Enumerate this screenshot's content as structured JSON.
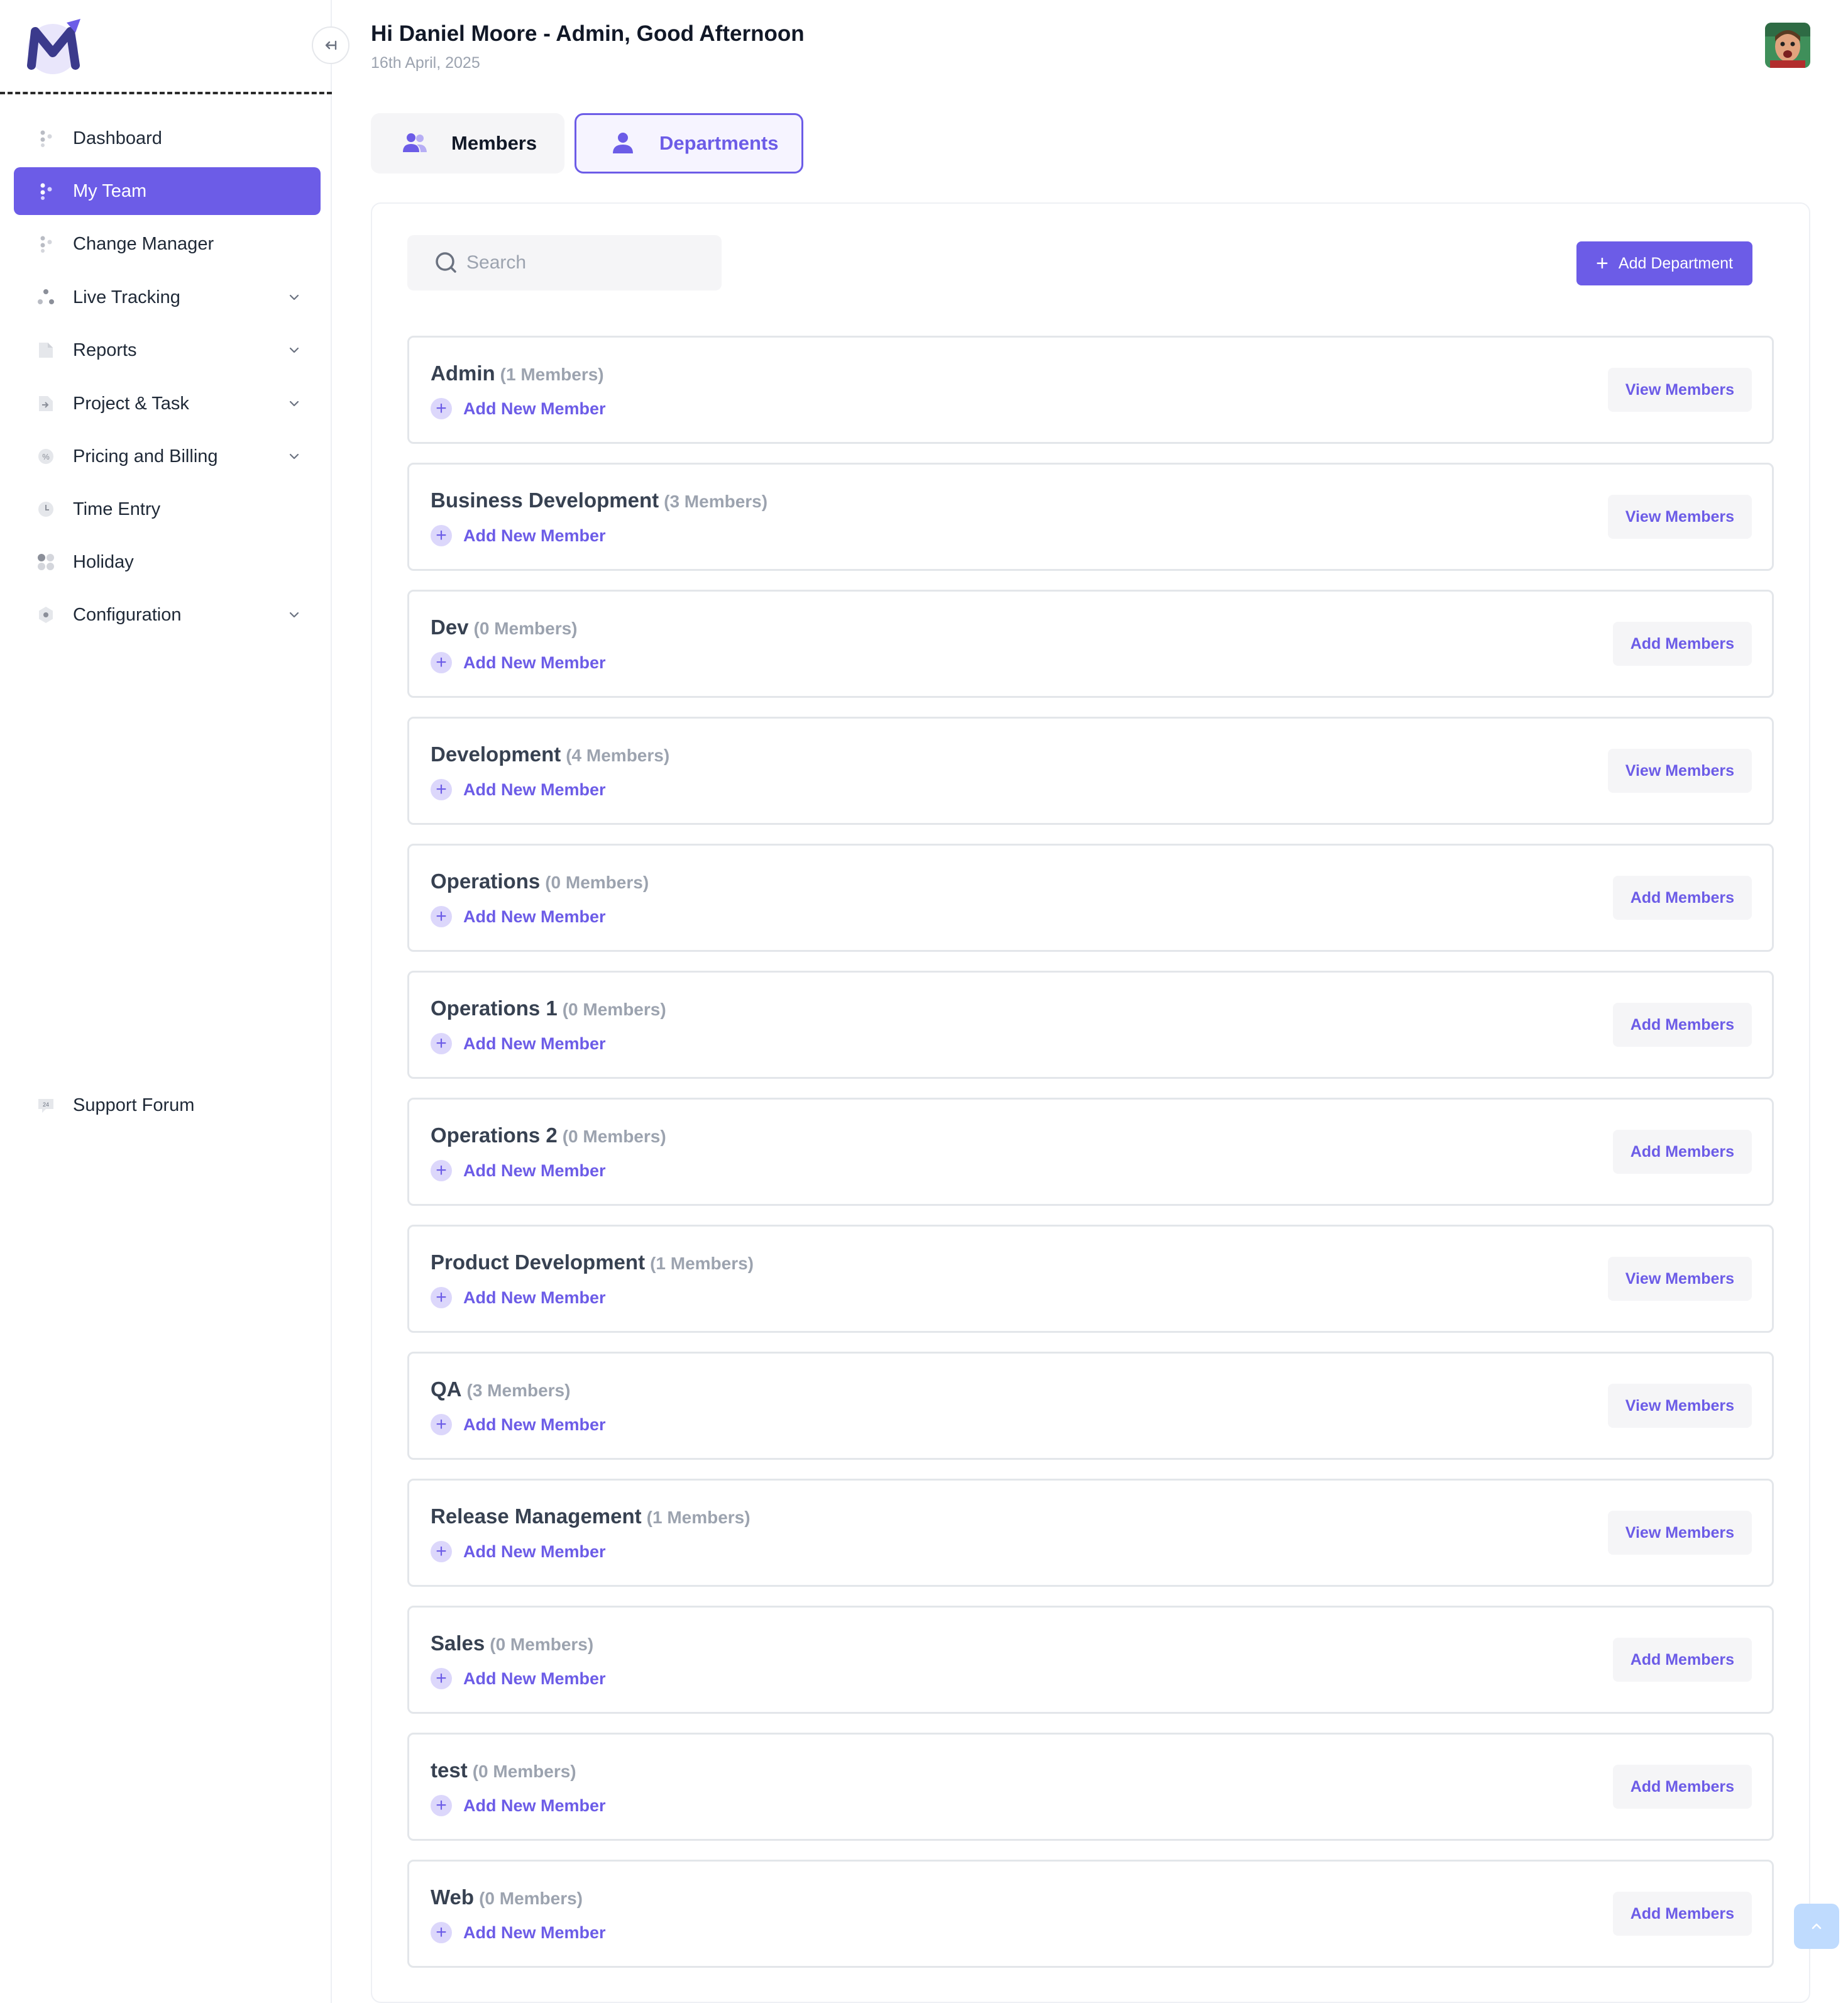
{
  "sidebar": {
    "items": [
      {
        "label": "Dashboard",
        "icon": "dashboard-icon",
        "active": false,
        "chevron": false
      },
      {
        "label": "My Team",
        "icon": "team-icon",
        "active": true,
        "chevron": false
      },
      {
        "label": "Change Manager",
        "icon": "change-manager-icon",
        "active": false,
        "chevron": false
      },
      {
        "label": "Live Tracking",
        "icon": "live-tracking-icon",
        "active": false,
        "chevron": true
      },
      {
        "label": "Reports",
        "icon": "reports-icon",
        "active": false,
        "chevron": true
      },
      {
        "label": "Project & Task",
        "icon": "project-task-icon",
        "active": false,
        "chevron": true
      },
      {
        "label": "Pricing and Billing",
        "icon": "pricing-billing-icon",
        "active": false,
        "chevron": true
      },
      {
        "label": "Time Entry",
        "icon": "clock-icon",
        "active": false,
        "chevron": false
      },
      {
        "label": "Holiday",
        "icon": "holiday-icon",
        "active": false,
        "chevron": false
      },
      {
        "label": "Configuration",
        "icon": "gear-icon",
        "active": false,
        "chevron": true
      }
    ],
    "support": {
      "label": "Support Forum",
      "icon": "support-24-icon",
      "badge": "24"
    }
  },
  "header": {
    "title": "Hi Daniel Moore - Admin, Good Afternoon",
    "date": "16th April, 2025"
  },
  "tabs": {
    "members": "Members",
    "departments": "Departments",
    "active": "departments"
  },
  "toolbar": {
    "search_placeholder": "Search",
    "add_department": "Add Department"
  },
  "departments": [
    {
      "name": "Admin",
      "count": "(1 Members)",
      "add_label": "Add New Member",
      "action": "View Members"
    },
    {
      "name": "Business Development",
      "count": "(3 Members)",
      "add_label": "Add New Member",
      "action": "View Members"
    },
    {
      "name": "Dev",
      "count": "(0 Members)",
      "add_label": "Add New Member",
      "action": "Add Members"
    },
    {
      "name": "Development",
      "count": "(4 Members)",
      "add_label": "Add New Member",
      "action": "View Members"
    },
    {
      "name": "Operations",
      "count": "(0 Members)",
      "add_label": "Add New Member",
      "action": "Add Members"
    },
    {
      "name": "Operations 1",
      "count": "(0 Members)",
      "add_label": "Add New Member",
      "action": "Add Members"
    },
    {
      "name": "Operations 2",
      "count": "(0 Members)",
      "add_label": "Add New Member",
      "action": "Add Members"
    },
    {
      "name": "Product Development",
      "count": "(1 Members)",
      "add_label": "Add New Member",
      "action": "View Members"
    },
    {
      "name": "QA",
      "count": "(3 Members)",
      "add_label": "Add New Member",
      "action": "View Members"
    },
    {
      "name": "Release Management",
      "count": "(1 Members)",
      "add_label": "Add New Member",
      "action": "View Members"
    },
    {
      "name": "Sales",
      "count": "(0 Members)",
      "add_label": "Add New Member",
      "action": "Add Members"
    },
    {
      "name": "test",
      "count": "(0 Members)",
      "add_label": "Add New Member",
      "action": "Add Members"
    },
    {
      "name": "Web",
      "count": "(0 Members)",
      "add_label": "Add New Member",
      "action": "Add Members"
    }
  ],
  "colors": {
    "accent": "#6c5ce7",
    "accent_light": "#dcd7fb",
    "border": "#e3e6ea",
    "muted_text": "#9ca3af"
  }
}
